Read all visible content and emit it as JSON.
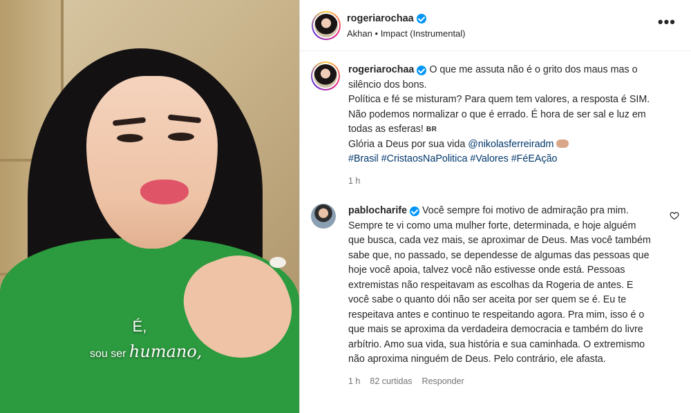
{
  "header": {
    "username": "rogeriarochaa",
    "artist": "Akhan",
    "separator": "•",
    "track": "Impact (Instrumental)",
    "more_icon": "more-options-icon"
  },
  "video": {
    "caption_line1": "É,",
    "caption_line2_prefix": "sou ser ",
    "caption_line2_emphasis": "humano,"
  },
  "post": {
    "username": "rogeriarochaa",
    "text_1": "O que me assuta não é o grito dos maus mas o silêncio dos bons.\nPolítica e fé se misturam? Para quem tem valores, a resposta é SIM. Não podemos normalizar o que é errado. É hora de ser sal e luz em todas as esferas! ",
    "flag_tag": "BR",
    "text_2": "Glória a Deus por sua vida ",
    "mention": "@nikolasferreiradm",
    "hashtags": "#Brasil #CristaosNaPolitica #Valores #FéEAção",
    "time": "1 h"
  },
  "reply": {
    "username": "pablocharife",
    "text": "Você sempre foi motivo de admiração pra mim. Sempre te vi como uma mulher forte, determinada, e hoje alguém que busca, cada vez mais, se aproximar de Deus. Mas você também sabe que, no passado, se dependesse de algumas das pessoas que hoje você apoia, talvez você não estivesse onde está. Pessoas extremistas não respeitavam as escolhas da Rogeria de antes. E você sabe o quanto dói não ser aceita por ser quem se é. Eu te respeitava antes e continuo te respeitando agora. Pra mim, isso é o que mais se aproxima da verdadeira democracia e também do livre arbítrio. Amo sua vida, sua história e sua caminhada. O extremismo não aproxima ninguém de Deus. Pelo contrário, ele afasta.",
    "time": "1 h",
    "likes": "82 curtidas",
    "reply_label": "Responder"
  },
  "colors": {
    "verified": "#0095f6",
    "link": "#00376b",
    "muted": "#737373",
    "shirt": "#2c9a3f"
  }
}
